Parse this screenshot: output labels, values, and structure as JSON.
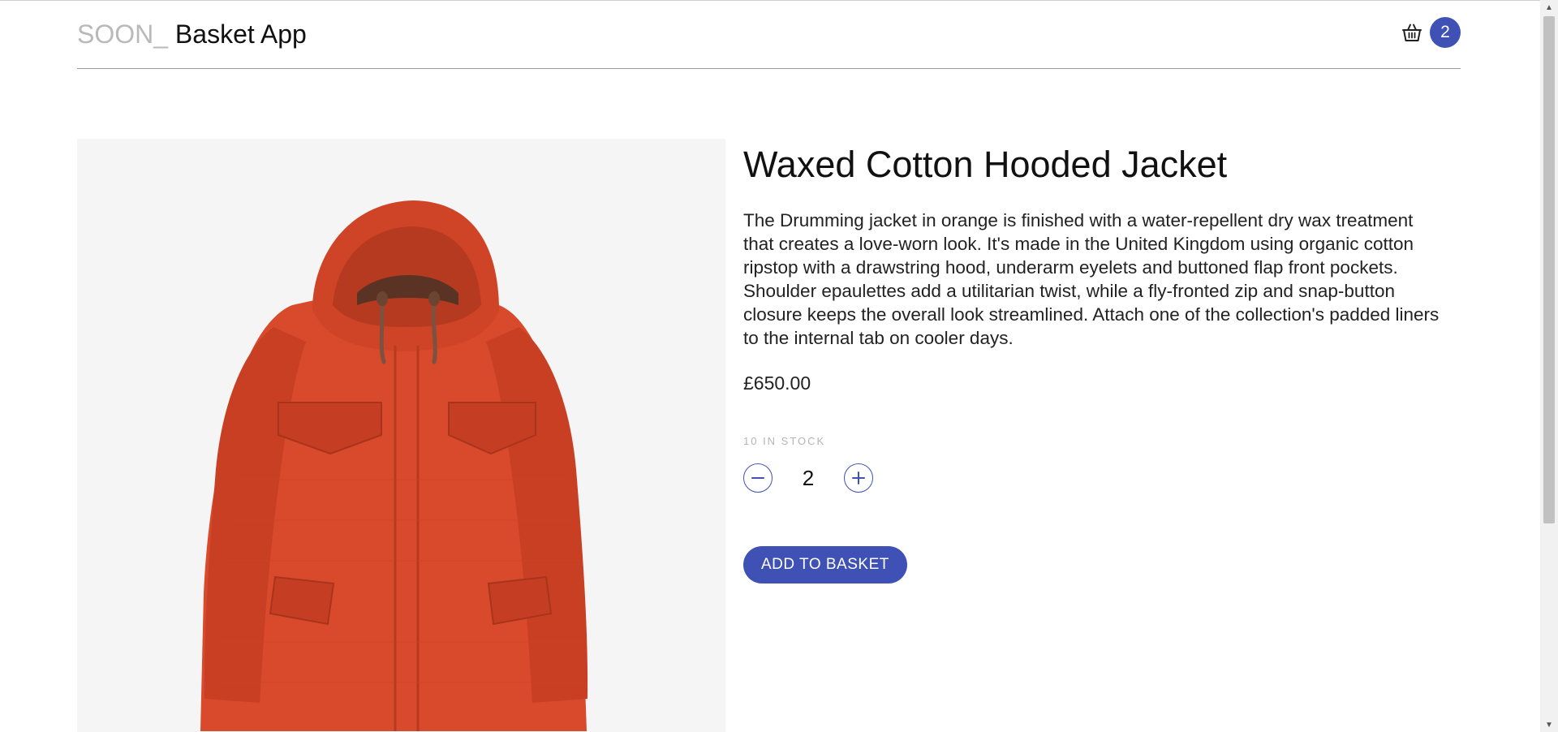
{
  "header": {
    "brand_prefix": "SOON_",
    "brand_name": "Basket App",
    "basket_icon": "basket-icon",
    "basket_count": "2",
    "accent": "#3f51b5"
  },
  "product": {
    "image_icon": "orange-hooded-jacket",
    "title": "Waxed Cotton Hooded Jacket",
    "description": "The Drumming jacket in orange is finished with a water-repellent dry wax treatment that creates a love-worn look. It's made in the United Kingdom using organic cotton ripstop with a drawstring hood, underarm eyelets and buttoned flap front pockets. Shoulder epaulettes add a utilitarian twist, while a fly-fronted zip and snap-button closure keeps the overall look streamlined. Attach one of the collection's padded liners to the internal tab on cooler days.",
    "price": "£650.00",
    "stock": "10 IN STOCK",
    "quantity": "2",
    "decrement_icon": "minus-icon",
    "increment_icon": "plus-icon",
    "add_button_label": "ADD TO BASKET"
  },
  "colors": {
    "jacket": "#d9492b",
    "image_bg": "#f5f5f5"
  }
}
